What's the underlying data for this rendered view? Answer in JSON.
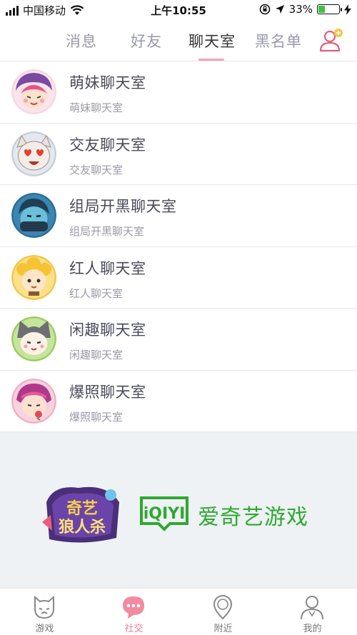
{
  "status_bar": {
    "carrier": "中国移动",
    "time": "上午10:55",
    "battery_percent": "33%",
    "battery_level": 0.33
  },
  "tabs": [
    {
      "label": "消息",
      "active": false
    },
    {
      "label": "好友",
      "active": false
    },
    {
      "label": "聊天室",
      "active": true
    },
    {
      "label": "黑名单",
      "active": false
    }
  ],
  "rooms": [
    {
      "title": "萌妹聊天室",
      "subtitle": "萌妹聊天室",
      "avatar": "girl-purple-hat-avatar",
      "color": "#f3c9d9"
    },
    {
      "title": "交友聊天室",
      "subtitle": "交友聊天室",
      "avatar": "heart-eyes-avatar",
      "color": "#d9dde6"
    },
    {
      "title": "组局开黑聊天室",
      "subtitle": "组局开黑聊天室",
      "avatar": "blue-ninja-avatar",
      "color": "#2d7da8"
    },
    {
      "title": "红人聊天室",
      "subtitle": "红人聊天室",
      "avatar": "yellow-hair-avatar",
      "color": "#f5c64a"
    },
    {
      "title": "闲趣聊天室",
      "subtitle": "闲趣聊天室",
      "avatar": "wolf-hood-avatar",
      "color": "#a6d36d"
    },
    {
      "title": "爆照聊天室",
      "subtitle": "爆照聊天室",
      "avatar": "pink-girl-avatar",
      "color": "#f2b6c8"
    }
  ],
  "logos": {
    "game_logo": "奇艺狼人杀",
    "iqiyi_logo": "iQIYI",
    "brand_text": "爱奇艺游戏",
    "brand_color": "#2fa82f"
  },
  "bottom_nav": [
    {
      "label": "游戏",
      "icon": "werewolf-icon",
      "active": false
    },
    {
      "label": "社交",
      "icon": "chat-bubble-icon",
      "active": true
    },
    {
      "label": "附近",
      "icon": "location-pin-icon",
      "active": false
    },
    {
      "label": "我的",
      "icon": "user-profile-icon",
      "active": false
    }
  ],
  "accent_color": "#ef7d95"
}
